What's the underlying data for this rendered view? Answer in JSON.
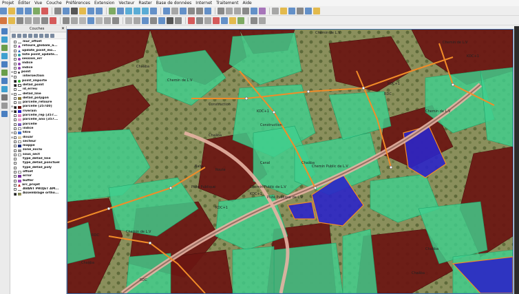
{
  "menu": [
    "Projet",
    "Éditer",
    "Vue",
    "Couche",
    "Préférences",
    "Extension",
    "Vecteur",
    "Raster",
    "Base de données",
    "Internet",
    "Traitement",
    "Aide"
  ],
  "colors": {
    "parcel_dark": "#6b1512",
    "parcel_green": "#3fcf8e",
    "parcel_blue": "#2b25c8",
    "orange_line": "#f28c28",
    "road": "#9a6e62",
    "map_border": "#3b6fb0"
  },
  "panel": {
    "title": "Couches",
    "close_icon": "close-icon"
  },
  "layers": [
    {
      "name": "mur_offset",
      "sym": "line-grey",
      "checked": false,
      "exp": ""
    },
    {
      "name": "retoure_globale_a...",
      "sym": "tri-purple",
      "checked": false,
      "exp": ""
    },
    {
      "name": "update_point_mo...",
      "sym": "tri-blue",
      "checked": false,
      "exp": ""
    },
    {
      "name": "liste point_update...",
      "sym": "dot-teal",
      "checked": false,
      "exp": ""
    },
    {
      "name": "session_err",
      "sym": "dot-purple",
      "checked": false,
      "exp": ""
    },
    {
      "name": "indice",
      "sym": "dot-purple",
      "checked": false,
      "exp": ""
    },
    {
      "name": "indice",
      "sym": "dot-purple",
      "checked": false,
      "exp": ""
    },
    {
      "name": "point",
      "sym": "dot-small",
      "checked": false,
      "exp": "+"
    },
    {
      "name": "intersection",
      "sym": "none",
      "checked": false,
      "exp": "+"
    },
    {
      "name": "point_importe",
      "sym": "dot-green",
      "checked": true,
      "exp": ""
    },
    {
      "name": "detail_point",
      "sym": "star",
      "checked": true,
      "exp": ""
    },
    {
      "name": "id_erreu",
      "sym": "line-grey",
      "checked": false,
      "exp": ""
    },
    {
      "name": "detail_line",
      "sym": "line-grey",
      "checked": false,
      "exp": "+"
    },
    {
      "name": "detail_polygon",
      "sym": "fill-olive",
      "checked": false,
      "exp": ""
    },
    {
      "name": "parcelle_retoure",
      "sym": "fill-grey",
      "checked": false,
      "exp": ""
    },
    {
      "name": "parcelle [25740]",
      "sym": "fill-darkred",
      "checked": true,
      "exp": "+"
    },
    {
      "name": "riverain",
      "sym": "fill-blue",
      "checked": true,
      "exp": "+"
    },
    {
      "name": "parcelle_rep [357...",
      "sym": "fill-pink",
      "checked": false,
      "exp": ""
    },
    {
      "name": "parcelle_ano [357...",
      "sym": "fill-pink2",
      "checked": false,
      "exp": ""
    },
    {
      "name": "parcelle",
      "sym": "fill-violet",
      "checked": false,
      "exp": ""
    },
    {
      "name": "indice",
      "sym": "fill-white",
      "checked": false,
      "exp": ""
    },
    {
      "name": "titre",
      "sym": "fill-blue2",
      "checked": false,
      "exp": "+"
    },
    {
      "name": "douar",
      "sym": "fill-beige",
      "checked": false,
      "exp": "+"
    },
    {
      "name": "secteur",
      "sym": "fill-white",
      "checked": false,
      "exp": ""
    },
    {
      "name": "mappe",
      "sym": "fill-navy",
      "checked": false,
      "exp": ""
    },
    {
      "name": "zone_exclu",
      "sym": "fill-grey2",
      "checked": false,
      "exp": ""
    },
    {
      "name": "sous_sect",
      "sym": "fill-white",
      "checked": false,
      "exp": ""
    },
    {
      "name": "type_detail_line",
      "sym": "none",
      "checked": false,
      "exp": ""
    },
    {
      "name": "type_detail_ponctuel",
      "sym": "none",
      "checked": false,
      "exp": ""
    },
    {
      "name": "type_detail_poly",
      "sym": "none",
      "checked": false,
      "exp": ""
    },
    {
      "name": "offset",
      "sym": "fill-white",
      "checked": false,
      "exp": ""
    },
    {
      "name": "error",
      "sym": "fill-purple",
      "checked": false,
      "exp": ""
    },
    {
      "name": "buffer",
      "sym": "fill-purple2",
      "checked": false,
      "exp": ""
    },
    {
      "name": "arc_projet",
      "sym": "tri-red",
      "checked": false,
      "exp": ""
    },
    {
      "name": "AVANT PROJET AM...",
      "sym": "line-grey",
      "checked": false,
      "exp": ""
    },
    {
      "name": "Assemblage ortho...",
      "sym": "raster",
      "checked": true,
      "exp": ""
    }
  ],
  "map_labels": [
    "Chemin de L.V",
    "Chemin de L.V",
    "Chemin de L.V",
    "Chemin de L.V",
    "Chemin de L.V",
    "Chaâba",
    "Chaâba",
    "Chaâba",
    "Chaâba",
    "Chaâba",
    "Chaâba",
    "KDC+1",
    "KDC+1",
    "KDC+1",
    "KDC+1",
    "KDC+1",
    "Construction",
    "Construction",
    "Chemin Public de L.V",
    "Chemin Public de L.V",
    "Piste Publique de L.V",
    "Piste Publique",
    "Route",
    "Baba",
    "Canal",
    "RDC",
    "RDC",
    "RDC"
  ]
}
